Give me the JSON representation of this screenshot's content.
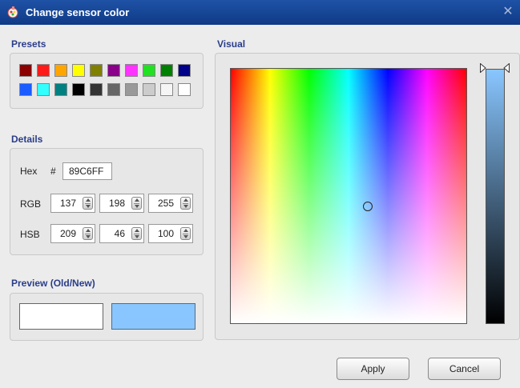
{
  "window": {
    "title": "Change sensor color",
    "close_icon": "close-icon"
  },
  "presets": {
    "label": "Presets",
    "row1": [
      "#8b0000",
      "#ff1a1a",
      "#ffa500",
      "#ffff00",
      "#808000",
      "#8b008b",
      "#ff33ff",
      "#22e022",
      "#008000",
      "#00008b"
    ],
    "row2": [
      "#1a5cff",
      "#33ffff",
      "#008080",
      "#000000",
      "#333333",
      "#666666",
      "#999999",
      "#cccccc",
      "#f5f5f5",
      "#ffffff"
    ]
  },
  "details": {
    "label": "Details",
    "hex_label": "Hex",
    "hash": "#",
    "hex_value": "89C6FF",
    "rgb_label": "RGB",
    "rgb": [
      "137",
      "198",
      "255"
    ],
    "hsb_label": "HSB",
    "hsb": [
      "209",
      "46",
      "100"
    ]
  },
  "preview": {
    "label": "Preview (Old/New)",
    "old_color": "#ffffff",
    "new_color": "#89c6ff"
  },
  "visual": {
    "label": "Visual",
    "selected_hue": 209,
    "selected_saturation": 46,
    "selected_brightness": 100,
    "slider_top_color": "#89c6ff",
    "slider_bottom_color": "#000000"
  },
  "buttons": {
    "apply": "Apply",
    "cancel": "Cancel"
  }
}
